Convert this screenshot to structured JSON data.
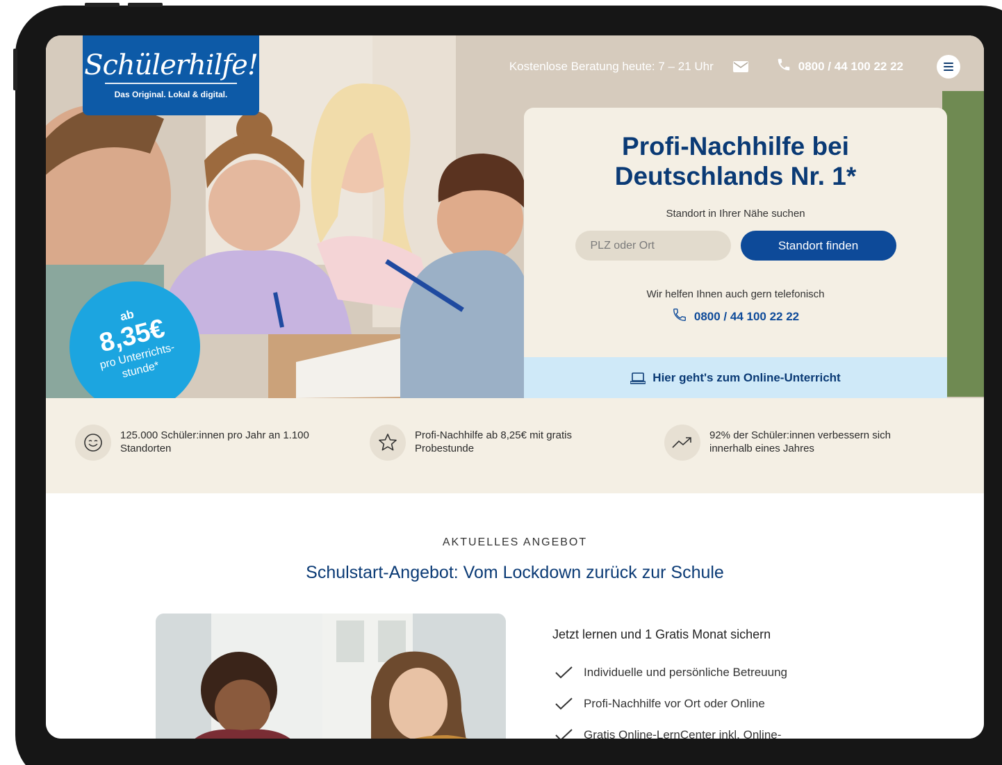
{
  "header": {
    "logo_script": "Schülerhilfe!",
    "logo_tagline": "Das Original. Lokal & digital.",
    "consult_text": "Kostenlose Beratung heute: 7 – 21 Uhr",
    "phone": "0800 / 44 100 22 22"
  },
  "hero": {
    "title": "Profi-Nachhilfe bei Deutschlands Nr. 1*",
    "search_label": "Standort in Ihrer Nähe suchen",
    "search_placeholder": "PLZ oder Ort",
    "search_button": "Standort finden",
    "help_text": "Wir helfen Ihnen auch gern telefonisch",
    "help_phone": "0800 / 44 100 22 22",
    "online_link": "Hier geht's zum Online-Unterricht",
    "price_badge": {
      "prefix": "ab",
      "price": "8,35€",
      "unit_line1": "pro Unterrichts-",
      "unit_line2": "stunde*"
    }
  },
  "features": [
    {
      "icon": "smiley-icon",
      "text": "125.000 Schüler:innen pro Jahr an 1.100 Standorten"
    },
    {
      "icon": "star-icon",
      "text": "Profi-Nachhilfe ab 8,25€ mit gratis Probestunde"
    },
    {
      "icon": "trend-up-icon",
      "text": "92% der Schüler:innen verbessern sich innerhalb eines Jahres"
    }
  ],
  "offer": {
    "eyebrow": "AKTUELLES ANGEBOT",
    "title": "Schulstart-Angebot: Vom Lockdown zurück zur Schule",
    "list_title": "Jetzt lernen und 1 Gratis Monat sichern",
    "items": [
      "Individuelle und persönliche Betreuung",
      "Profi-Nachhilfe vor Ort oder Online",
      "Gratis Online-LernCenter inkl. Online-"
    ]
  },
  "colors": {
    "brand_blue": "#0d5aa7",
    "dark_blue": "#0a3a75",
    "badge_cyan": "#1ca5e0",
    "cream": "#f4efe4",
    "online_bar": "#cfe9f8"
  }
}
